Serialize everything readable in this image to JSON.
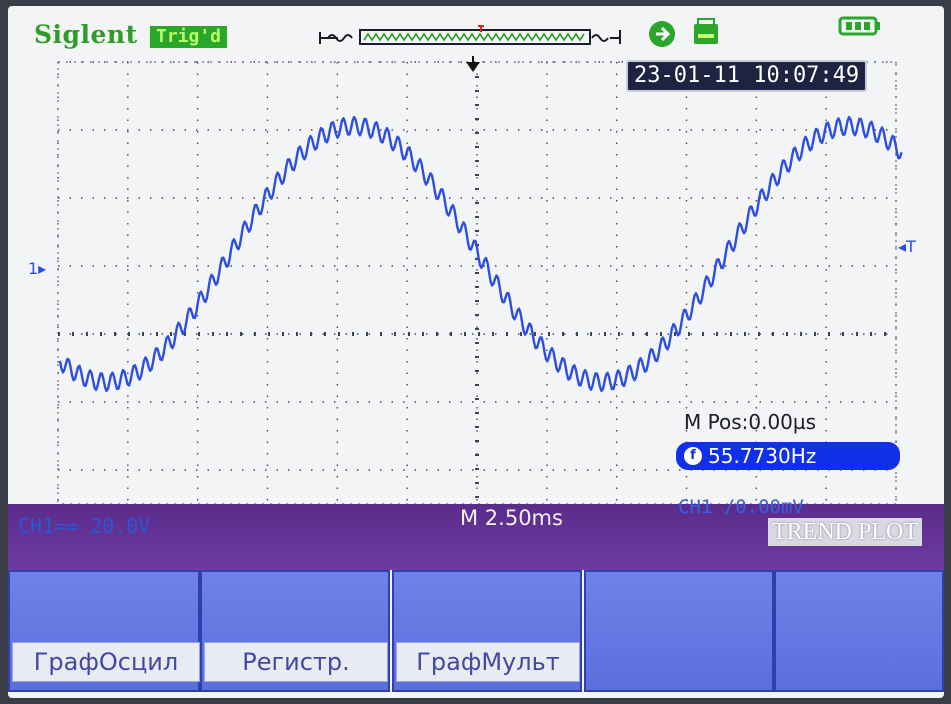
{
  "header": {
    "brand": "Siglent",
    "trigger_status": "Trig'd",
    "datetime": "23-01-11 10:07:49"
  },
  "markers": {
    "channel_marker": "1",
    "trigger_level_marker": "T"
  },
  "measurements": {
    "m_pos": "M Pos:0.00µs",
    "frequency": "55.7730Hz",
    "frequency_icon": "f"
  },
  "status_strip": {
    "ch1_scale": "CH1== 20.0V",
    "timebase": "M 2.50ms",
    "trigger_info": "CH1 /0.00mV",
    "mode_label": "TREND PLOT"
  },
  "softkeys": [
    {
      "label": "ГрафОсцил"
    },
    {
      "label": "Регистр."
    },
    {
      "label": "ГрафМульт"
    },
    {
      "label": ""
    },
    {
      "label": ""
    }
  ],
  "colors": {
    "trace": "#2d4fe0",
    "brand": "#2f9b2a",
    "trig_badge": "#2aa72a",
    "status_strip": "#5a2c8a",
    "softkey": "#6477e2",
    "screen": "#f3f4f6"
  },
  "icons": [
    "memory-depth-icon",
    "usb-icon",
    "printer-icon",
    "battery-icon",
    "trigger-position-icon",
    "channel-1-marker-icon",
    "trigger-level-icon"
  ]
}
